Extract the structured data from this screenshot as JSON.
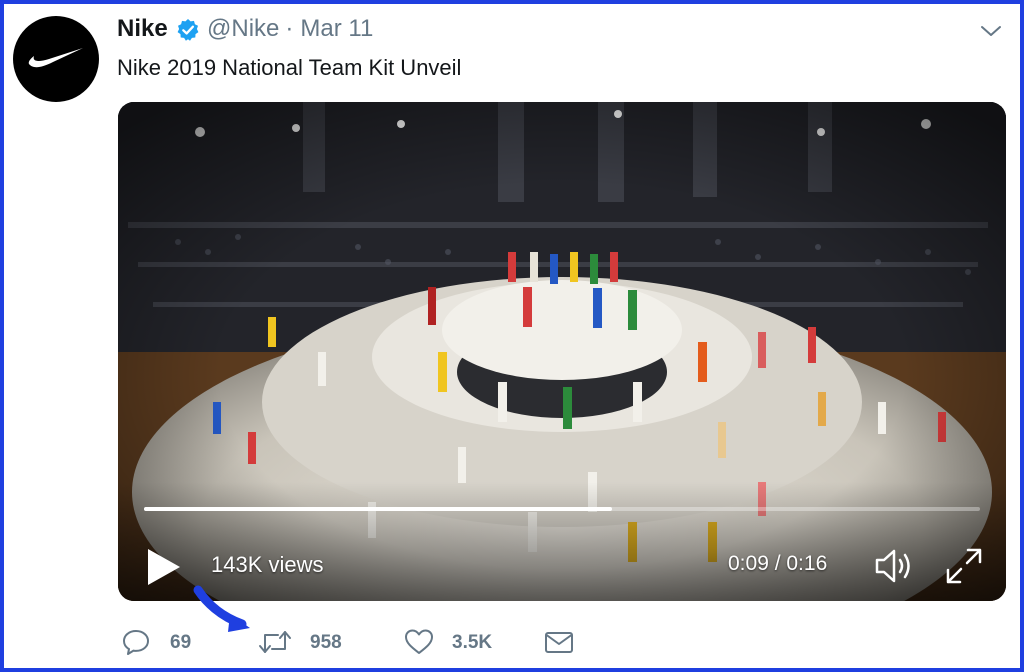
{
  "tweet": {
    "author_name": "Nike",
    "handle": "@Nike",
    "separator": "·",
    "date": "Mar 11",
    "text": "Nike 2019 National Team Kit Unveil"
  },
  "video": {
    "views": "143K views",
    "time": "0:09 / 0:16",
    "progress": 0.56
  },
  "actions": {
    "reply_count": "69",
    "retweet_count": "958",
    "like_count": "3.5K"
  },
  "colors": {
    "frame": "#1f3fe0",
    "verified": "#1da1f2",
    "muted_text": "#657786",
    "annotation_arrow": "#1f3fe0"
  }
}
